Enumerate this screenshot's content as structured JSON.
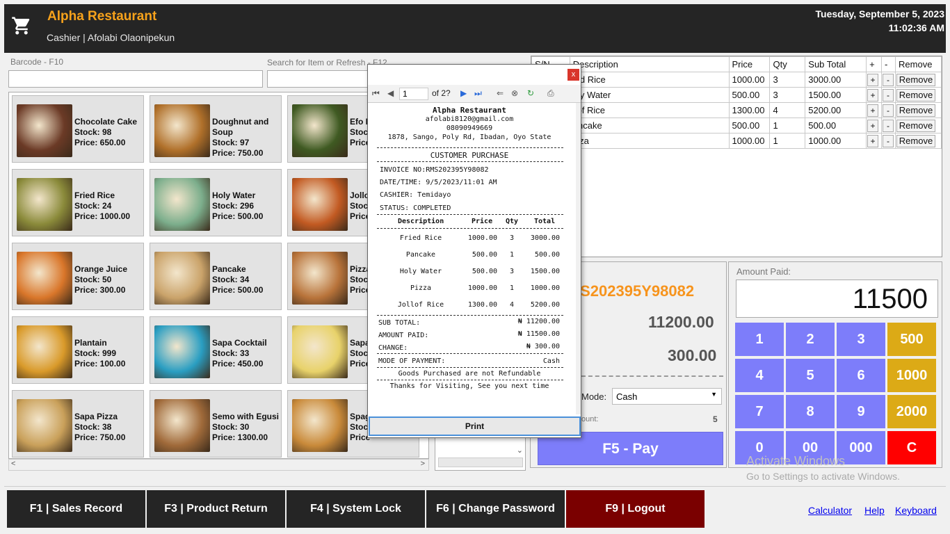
{
  "header": {
    "title": "Alpha Restaurant",
    "user": "Cashier | Afolabi Olaonipekun",
    "date": "Tuesday, September 5, 2023",
    "time": "11:02:36 AM",
    "icon": "shopping-cart-icon"
  },
  "search": {
    "barcode_label": "Barcode - F10",
    "search_label": "Search for Item or Refresh - F12"
  },
  "products": [
    {
      "name": "Chocolate Cake",
      "stock": "Stock: 98",
      "price": "Price: 650.00",
      "color": "#6b3a26"
    },
    {
      "name": "Doughnut and Soup",
      "stock": "Stock: 97",
      "price": "Price: 750.00",
      "color": "#b0702a"
    },
    {
      "name": "Efo Riro",
      "stock": "Stock",
      "price": "Price",
      "color": "#3f5a22"
    },
    {
      "name": "Fried Rice",
      "stock": "Stock: 24",
      "price": "Price: 1000.00",
      "color": "#8a8a3a"
    },
    {
      "name": "Holy Water",
      "stock": "Stock: 296",
      "price": "Price: 500.00",
      "color": "#7cae8c"
    },
    {
      "name": "Jollof",
      "stock": "Stock",
      "price": "Price",
      "color": "#c25a22"
    },
    {
      "name": "Orange Juice",
      "stock": "Stock: 50",
      "price": "Price: 300.00",
      "color": "#d9762a"
    },
    {
      "name": "Pancake",
      "stock": "Stock: 34",
      "price": "Price: 500.00",
      "color": "#caa36a"
    },
    {
      "name": "Pizza",
      "stock": "Stock",
      "price": "Price",
      "color": "#b8733a"
    },
    {
      "name": "Plantain",
      "stock": "Stock: 999",
      "price": "Price: 100.00",
      "color": "#d99a2a"
    },
    {
      "name": "Sapa Cocktail",
      "stock": "Stock: 33",
      "price": "Price: 450.00",
      "color": "#2a9ec2"
    },
    {
      "name": "Sapa",
      "stock": "Stoc",
      "price": "Price",
      "color": "#e8d26a"
    },
    {
      "name": "Sapa Pizza",
      "stock": "Stock: 38",
      "price": "Price: 750.00",
      "color": "#c9a05a"
    },
    {
      "name": "Semo with Egusi",
      "stock": "Stock: 30",
      "price": "Price: 1300.00",
      "color": "#a06a3a"
    },
    {
      "name": "Spag",
      "stock": "Stoc",
      "price": "Price",
      "color": "#c98a3a"
    }
  ],
  "cart": {
    "headers": [
      "S/N",
      "Description",
      "Price",
      "Qty",
      "Sub Total",
      "+",
      "-",
      "Remove"
    ],
    "rows": [
      {
        "desc": "ied Rice",
        "price": "1000.00",
        "qty": "3",
        "sub": "3000.00"
      },
      {
        "desc": "oly Water",
        "price": "500.00",
        "qty": "3",
        "sub": "1500.00"
      },
      {
        "desc": "llof Rice",
        "price": "1300.00",
        "qty": "4",
        "sub": "5200.00"
      },
      {
        "desc": "ancake",
        "price": "500.00",
        "qty": "1",
        "sub": "500.00"
      },
      {
        "desc": "izza",
        "price": "1000.00",
        "qty": "1",
        "sub": "1000.00"
      }
    ],
    "plus": "+",
    "minus": "-",
    "remove": "Remove"
  },
  "totals": {
    "invoice": "IS202395Y98082",
    "subtotal": "11200.00",
    "change": "300.00",
    "mode_label": "Mode:",
    "mode_value": "Cash",
    "count_label": "ount:",
    "count_value": "5",
    "pay_label": "F5 - Pay"
  },
  "keypad": {
    "label": "Amount Paid:",
    "amount": "11500",
    "keys": [
      "1",
      "2",
      "3",
      "500",
      "4",
      "5",
      "6",
      "1000",
      "7",
      "8",
      "9",
      "2000",
      "0",
      "00",
      "000",
      "C"
    ]
  },
  "watermark": {
    "line1": "Activate Windows",
    "line2": "Go to Settings to activate Windows."
  },
  "footer": {
    "buttons": [
      "F1 | Sales Record",
      "F3 | Product Return",
      "F4 | System Lock",
      "F6 | Change Password",
      "F9 | Logout"
    ],
    "links": [
      "Calculator",
      "Help",
      "Keyboard"
    ]
  },
  "dialog": {
    "close": "x",
    "page": "1",
    "of_pages": "of 2?",
    "print_label": "Print"
  },
  "receipt": {
    "name": "Alpha Restaurant",
    "email": "afolabi8120@gmail.com",
    "phone": "08090949669",
    "address": "1878, Sango, Poly Rd, Ibadan, Oyo State",
    "heading": "CUSTOMER PURCHASE",
    "invoice": "INVOICE NO:RMS202395Y98082",
    "datetime": "DATE/TIME: 9/5/2023/11:01 AM",
    "cashier": "CASHIER:   Temidayo",
    "status": "STATUS:    COMPLETED",
    "cols": [
      "Description",
      "Price",
      "Qty",
      "Total"
    ],
    "items": [
      {
        "d": "Fried Rice",
        "p": "1000.00",
        "q": "3",
        "t": "3000.00"
      },
      {
        "d": "Pancake",
        "p": "500.00",
        "q": "1",
        "t": "500.00"
      },
      {
        "d": "Holy Water",
        "p": "500.00",
        "q": "3",
        "t": "1500.00"
      },
      {
        "d": "Pizza",
        "p": "1000.00",
        "q": "1",
        "t": "1000.00"
      },
      {
        "d": "Jollof Rice",
        "p": "1300.00",
        "q": "4",
        "t": "5200.00"
      }
    ],
    "sub_total_label": "SUB TOTAL:",
    "sub_total": "₦ 11200.00",
    "paid_label": "AMOUNT PAID:",
    "paid": "₦ 11500.00",
    "change_label": "CHANGE:",
    "change": "₦ 300.00",
    "mode_label": "MODE OF PAYMENT:",
    "mode": "Cash",
    "note": "Goods Purchased are not Refundable",
    "thanks": "Thanks for Visiting, See you next time"
  }
}
